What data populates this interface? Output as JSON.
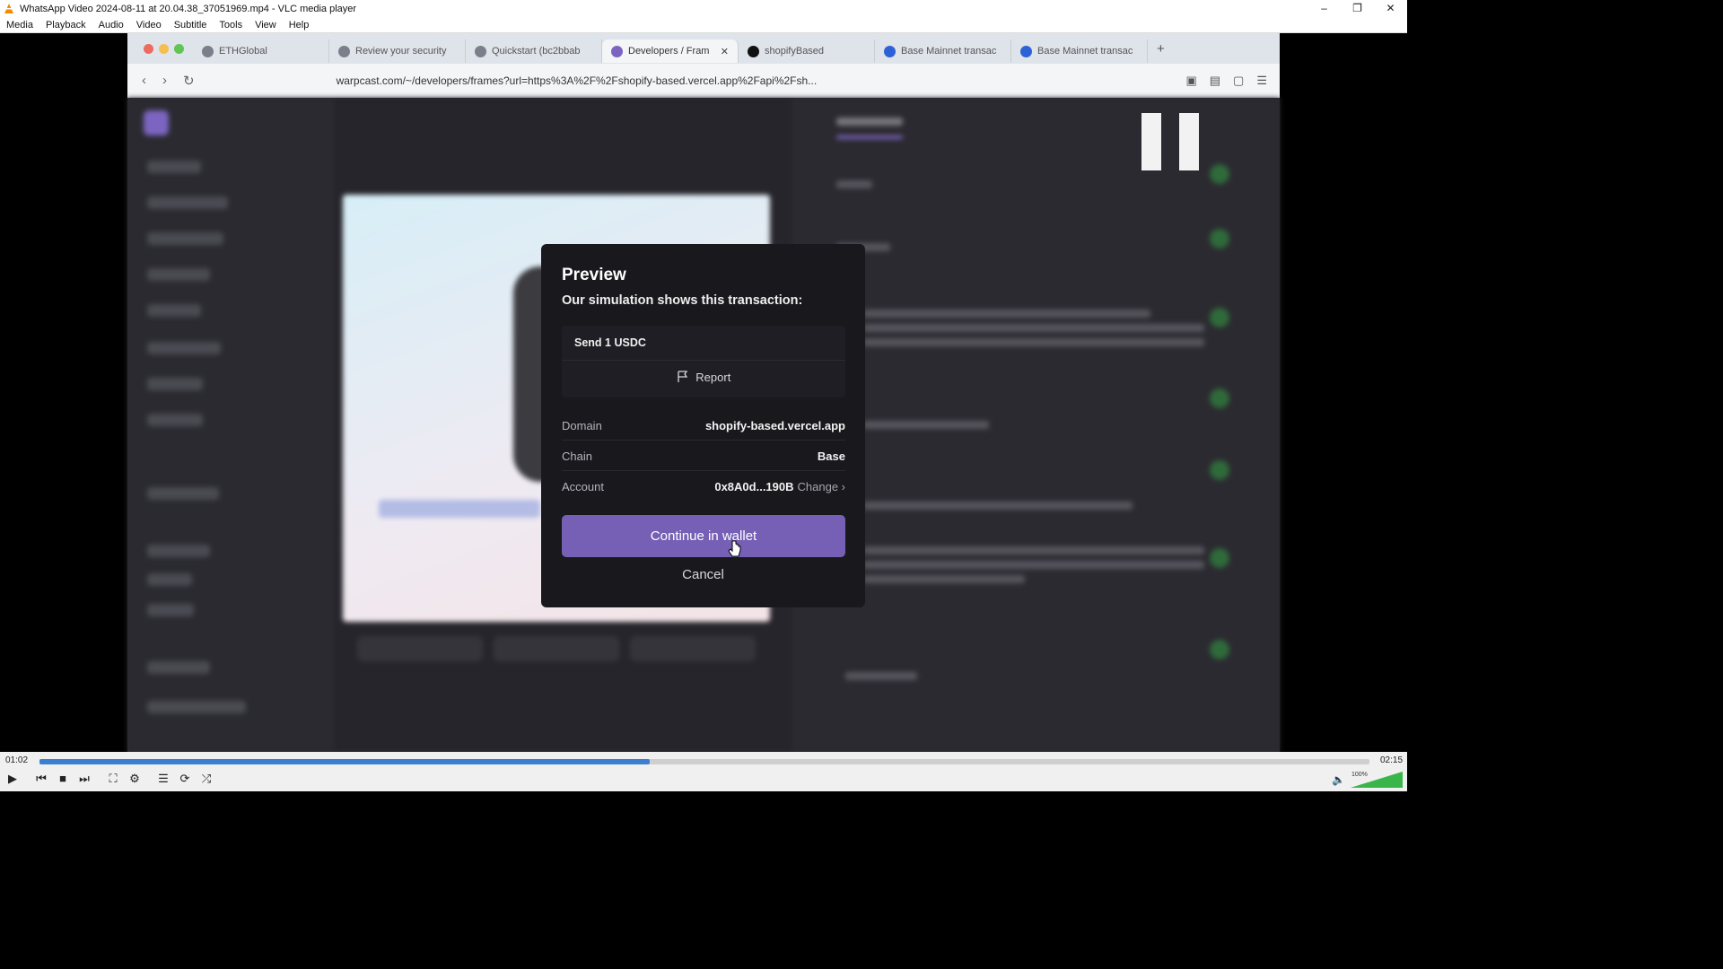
{
  "window": {
    "title": "WhatsApp Video 2024-08-11 at 20.04.38_37051969.mp4 - VLC media player",
    "controls": [
      "–",
      "❐",
      "✕"
    ]
  },
  "menu": [
    "Media",
    "Playback",
    "Audio",
    "Video",
    "Subtitle",
    "Tools",
    "View",
    "Help"
  ],
  "browser": {
    "tabs": [
      {
        "label": "ETHGlobal"
      },
      {
        "label": "Review your security"
      },
      {
        "label": "Quickstart (bc2bbab"
      },
      {
        "label": "Developers / Fram",
        "active": true
      },
      {
        "label": "shopifyBased"
      },
      {
        "label": "Base Mainnet transac"
      },
      {
        "label": "Base Mainnet transac"
      }
    ],
    "url": "warpcast.com/~/developers/frames?url=https%3A%2F%2Fshopify-based.vercel.app%2Fapi%2Fsh..."
  },
  "modal": {
    "title": "Preview",
    "subtitle": "Our simulation shows this transaction:",
    "transaction": "Send 1 USDC",
    "report_label": "Report",
    "domain_label": "Domain",
    "domain_value": "shopify-based.vercel.app",
    "chain_label": "Chain",
    "chain_value": "Base",
    "account_label": "Account",
    "account_value": "0x8A0d...190B",
    "change_label": "Change ›",
    "continue_label": "Continue in wallet",
    "cancel_label": "Cancel"
  },
  "player": {
    "elapsed": "01:02",
    "total": "02:15",
    "progress": 0.459,
    "volume": "100%",
    "accent": "#3a7fd0"
  }
}
